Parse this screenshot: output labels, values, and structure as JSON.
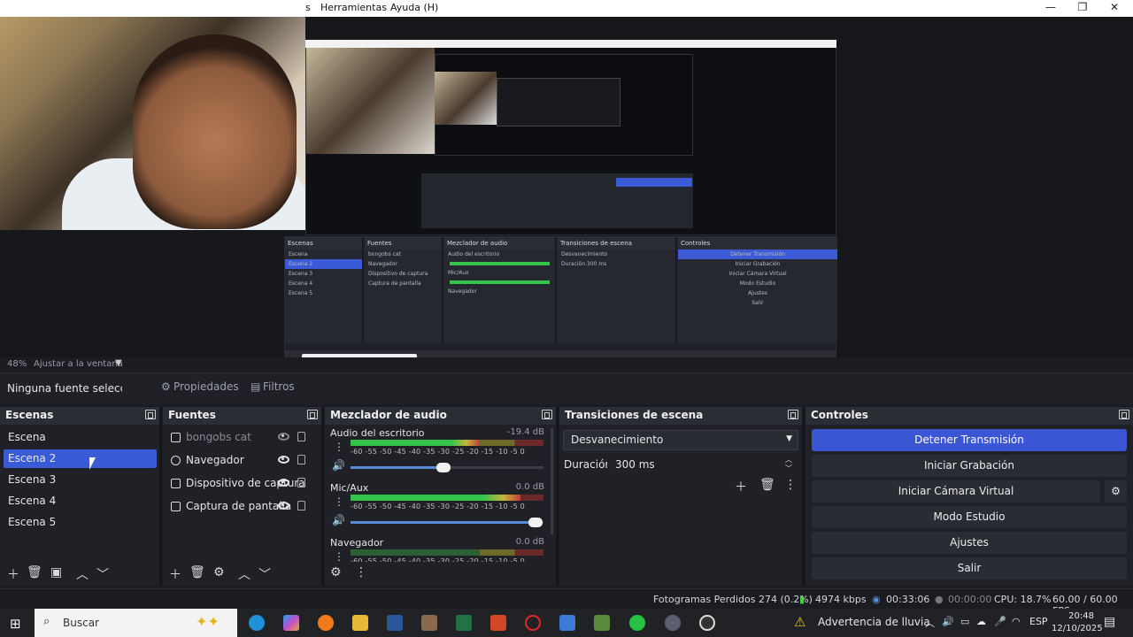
{
  "window": {
    "menu_herramientas": "Herramientas",
    "menu_ayuda": "Ayuda (H)",
    "minimize": "—",
    "maximize": "❐",
    "close": "✕"
  },
  "preview": {
    "zoom": "48%",
    "fit": "Ajustar a la ventana"
  },
  "source_toolbar": {
    "no_source": "Ninguna fuente seleccionada",
    "properties": "Propiedades",
    "filters": "Filtros"
  },
  "scenes": {
    "title": "Escenas",
    "items": [
      "Escena",
      "Escena 2",
      "Escena 3",
      "Escena 4",
      "Escena 5"
    ],
    "selected_index": 1
  },
  "sources": {
    "title": "Fuentes",
    "items": [
      {
        "label": "bongobs cat",
        "visible": false
      },
      {
        "label": "Navegador",
        "visible": true
      },
      {
        "label": "Dispositivo de captura",
        "visible": true
      },
      {
        "label": "Captura de pantalla",
        "visible": true
      }
    ]
  },
  "mixer": {
    "title": "Mezclador de audio",
    "ticks": "-60 -55 -50 -45 -40 -35 -30 -25 -20 -15 -10 -5  0",
    "channels": [
      {
        "name": "Audio del escritorio",
        "db": "-19.4 dB",
        "level": 0.67,
        "volume": 0.48
      },
      {
        "name": "Mic/Aux",
        "db": "0.0 dB",
        "level": 0.88,
        "volume": 0.96
      },
      {
        "name": "Navegador",
        "db": "0.0 dB",
        "level": 0.0,
        "volume": 0.5
      }
    ]
  },
  "transitions": {
    "title": "Transiciones de escena",
    "selected": "Desvanecimiento",
    "duration_label": "Duración",
    "duration_value": "300 ms"
  },
  "controls": {
    "title": "Controles",
    "stop_stream": "Detener Transmisión",
    "start_recording": "Iniciar Grabación",
    "start_virtual_cam": "Iniciar Cámara Virtual",
    "studio_mode": "Modo Estudio",
    "settings": "Ajustes",
    "exit": "Salir"
  },
  "status": {
    "dropped_frames": "Fotogramas Perdidos 274 (0.2%)",
    "bitrate": "4974 kbps",
    "stream_time": "00:33:06",
    "rec_time": "00:00:00",
    "cpu": "CPU: 18.7%",
    "fps": "60.00 / 60.00 FPS"
  },
  "taskbar": {
    "search_placeholder": "Buscar",
    "weather": "Advertencia de lluvia",
    "language": "ESP",
    "time": "20:48",
    "date": "12/10/2025"
  }
}
